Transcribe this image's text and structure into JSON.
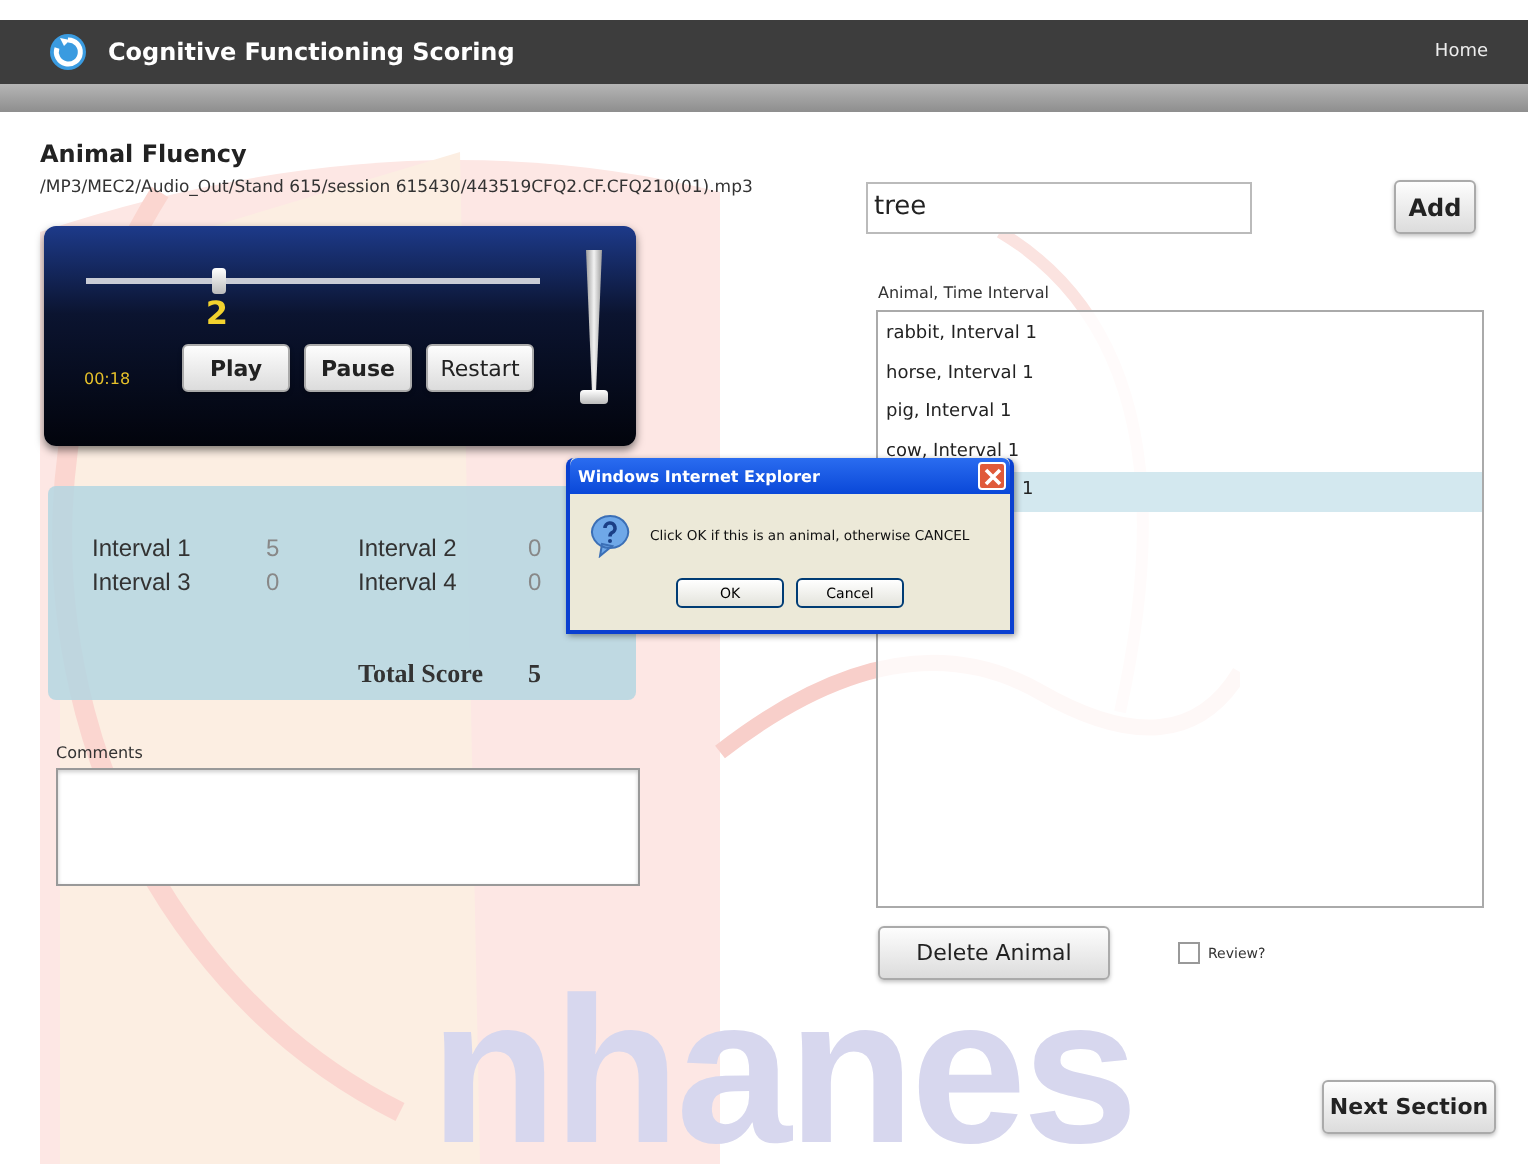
{
  "header": {
    "title": "Cognitive Functioning Scoring",
    "nav": [
      "Home"
    ]
  },
  "section": {
    "title": "Animal Fluency",
    "file_path": "/MP3/MEC2/Audio_Out/Stand 615/session 615430/443519CFQ2.CF.CFQ210(01).mp3"
  },
  "player": {
    "position_label": "2",
    "level": 0.29,
    "time": "00:18",
    "buttons": [
      "Play",
      "Pause",
      "Restart"
    ],
    "volume": {
      "level": 0
    }
  },
  "scores": {
    "intervals": [
      {
        "label": "Interval 1",
        "value": "5"
      },
      {
        "label": "Interval 2",
        "value": "0"
      },
      {
        "label": "Interval 3",
        "value": "0"
      },
      {
        "label": "Interval 4",
        "value": "0"
      }
    ],
    "total_label": "Total Score",
    "total": "5"
  },
  "comments": {
    "label": "Comments"
  },
  "animal_entry": {
    "value": "tree",
    "button": "Add"
  },
  "animal_list": {
    "label": "Animal, Time Interval",
    "items": [
      {
        "text": "rabbit, Interval 1",
        "selected": false,
        "covered": false
      },
      {
        "text": "horse, Interval 1",
        "selected": false,
        "covered": false
      },
      {
        "text": "pig, Interval 1",
        "selected": false,
        "covered": false
      },
      {
        "text": "cow, Interval 1",
        "selected": false,
        "covered": false
      },
      {
        "text": "1",
        "selected": true,
        "covered": true
      }
    ]
  },
  "delete_button": "Delete Animal",
  "review": {
    "label": "Review?",
    "checked": false
  },
  "next_button": "Next Section",
  "background_logo": "nhanes",
  "dialog": {
    "title": "Windows Internet Explorer",
    "message": "Click OK if this is an animal, otherwise CANCEL",
    "buttons": [
      "OK",
      "Cancel"
    ]
  }
}
